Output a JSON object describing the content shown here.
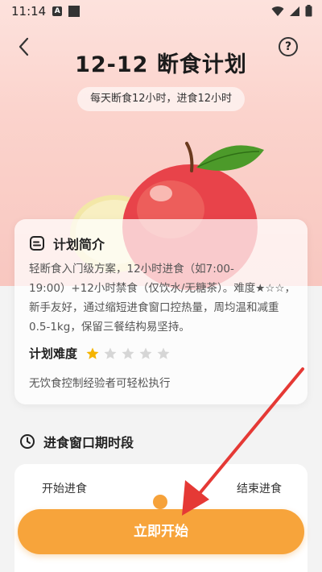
{
  "status_bar": {
    "time": "11:14",
    "icons": [
      "notification-a-icon",
      "notification-square-icon",
      "wifi-icon",
      "signal-icon",
      "battery-icon"
    ]
  },
  "header": {
    "back_icon": "chevron-left-icon",
    "help_icon": "question-circle-icon",
    "help_glyph": "?",
    "title": "12-12 断食计划",
    "subtitle": "每天断食12小时，进食12小时"
  },
  "intro": {
    "heading": "计划简介",
    "description": "轻断食入门级方案，12小时进食（如7:00-19:00）+12小时禁食（仅饮水/无糖茶）。难度★☆☆，新手友好，通过缩短进食窗口控热量，周均温和减重0.5-1kg，保留三餐结构易坚持。",
    "difficulty_label": "计划难度",
    "difficulty_rating": 1,
    "difficulty_max": 5,
    "difficulty_note": "无饮食控制经验者可轻松执行"
  },
  "eating_window": {
    "heading": "进食窗口期时段",
    "start_label": "开始进食",
    "end_label": "结束进食"
  },
  "actions": {
    "start_button": "立即开始"
  },
  "colors": {
    "accent": "#f7a43b",
    "hero_bg": "#fbd3cc",
    "arrow": "#e53935",
    "star_active": "#f5b400",
    "star_inactive": "#d6d6d6"
  }
}
